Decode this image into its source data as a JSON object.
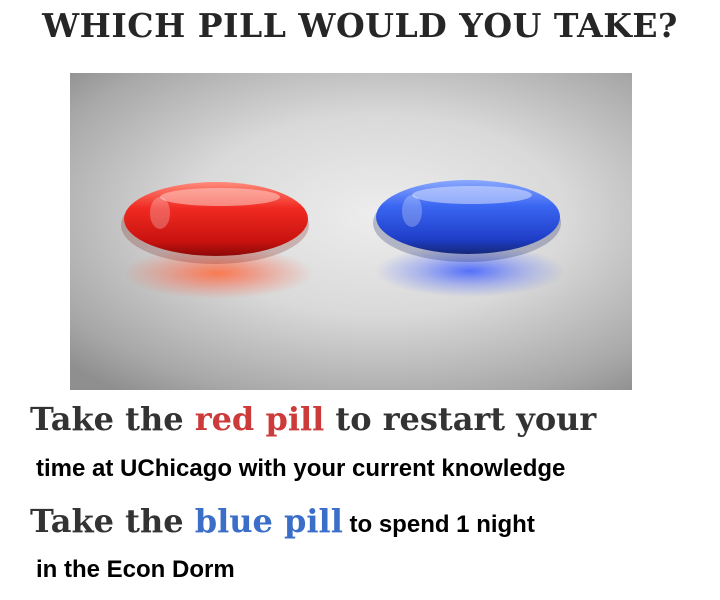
{
  "title": "WHICH PILL WOULD YOU TAKE?",
  "red_option": {
    "prefix": "Take the ",
    "highlight": "red pill",
    "suffix": " to restart your",
    "continuation": "time at UChicago with your current knowledge",
    "color": "#cc3a3a"
  },
  "blue_option": {
    "prefix": "Take the ",
    "highlight": "blue pill",
    "suffix": " to spend 1 night",
    "continuation": "in the Econ Dorm",
    "color": "#3a6ec8"
  },
  "image": {
    "description_icons": [
      "red-pill",
      "blue-pill"
    ]
  }
}
